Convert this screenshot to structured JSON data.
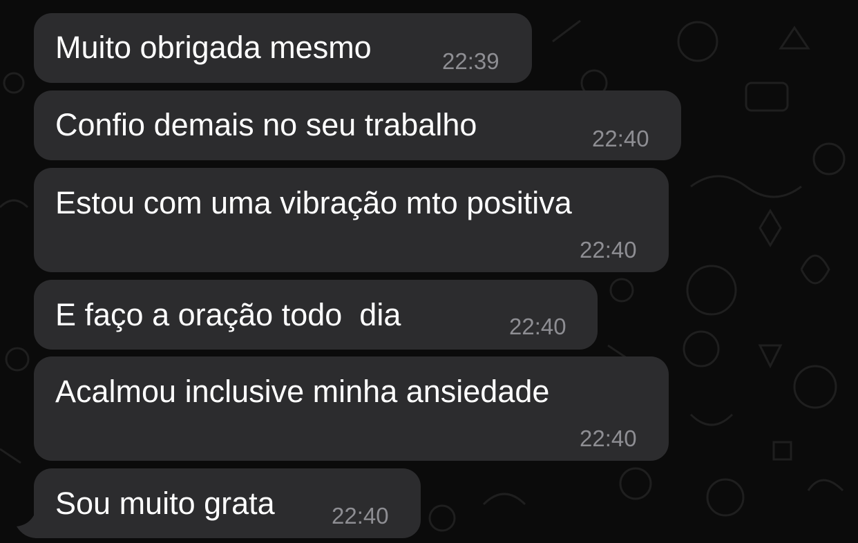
{
  "chat": {
    "messages": [
      {
        "text": "Muito obrigada mesmo",
        "time": "22:39"
      },
      {
        "text": "Confio demais no seu trabalho",
        "time": "22:40"
      },
      {
        "text": "Estou com uma vibração mto positiva",
        "time": "22:40"
      },
      {
        "text": "E faço a oração todo  dia",
        "time": "22:40"
      },
      {
        "text": "Acalmou inclusive minha ansiedade",
        "time": "22:40"
      },
      {
        "text": "Sou muito grata",
        "time": "22:40"
      }
    ]
  },
  "colors": {
    "background": "#0b0b0b",
    "bubble": "#2c2c2e",
    "text": "#ffffff",
    "timestamp": "#8e8e93",
    "doodle": "#1e1e1e"
  },
  "icons": [
    "chat-wallpaper-doodles",
    "bubble-tail"
  ]
}
